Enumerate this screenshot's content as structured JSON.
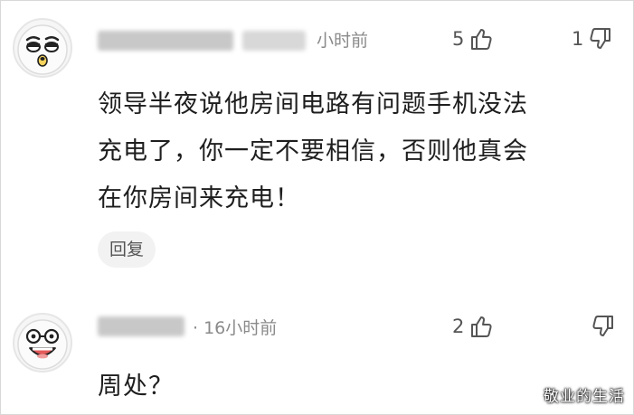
{
  "comments": [
    {
      "time": "小时前",
      "like_count": "5",
      "dislike_count": "1",
      "text": "领导半夜说他房间电路有问题手机没法\n充电了，你一定不要相信，否则他真会\n在你房间来充电！",
      "reply_label": "回复"
    },
    {
      "time": "· 16小时前",
      "like_count": "2",
      "dislike_count": "",
      "text": "周处？"
    }
  ],
  "watermark": "敬业的生活",
  "icons": {
    "like": "thumbs-up-icon",
    "dislike": "thumbs-down-icon"
  }
}
